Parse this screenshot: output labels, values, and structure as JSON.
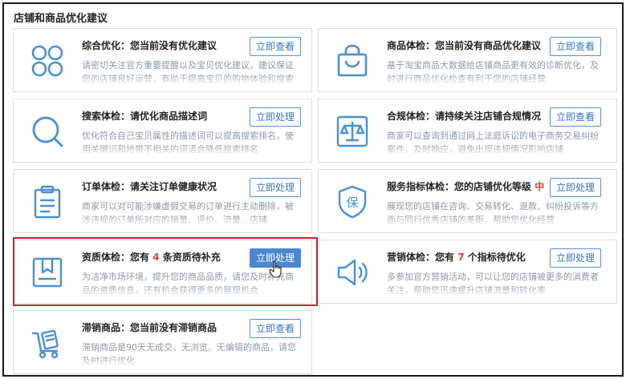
{
  "section_title": "店铺和商品优化建议",
  "cards": [
    {
      "icon": "apps-grid-icon",
      "title": "综合优化：您当前没有优化建议",
      "button": "立即查看",
      "desc": "请密切关注官方重要提醒以及宝贝优化建议，建议保证您的店铺良好运营，有助于提高宝贝的购物体验和搜索曝光"
    },
    {
      "icon": "shopping-bag-icon",
      "title": "商品体检：您当前没有商品优化建议",
      "button": "立即查看",
      "desc": "基于淘宝商品大数据给店铺商品更有效的诊断优化，及时进行商品优化检查有利于您的店铺经营"
    },
    {
      "icon": "search-icon",
      "title": "搜索体检：请优化商品描述词",
      "button": "立即处理",
      "desc": "优化符合自己宝贝属性的描述词可以提高搜索排名，使用关键词和地带不相关的词语会降低搜索排名"
    },
    {
      "icon": "scale-icon",
      "title": "合规体检：请持续关注店铺合规情况",
      "button": "立即查看",
      "desc": "商家可以查询到通过网上法庭诉讼的电子商务交易纠纷案件，及时响应，避免出现违规情况影响店铺"
    },
    {
      "icon": "clipboard-icon",
      "title": "订单体检：请关注订单健康状况",
      "button": "立即处理",
      "desc": "商家可以对可能涉嫌虚假交易的订单进行主动删除，被涉违规的订单所对应的销量、评价、流量、店铺"
    },
    {
      "icon": "shield-icon",
      "title": "服务指标体检：您的店铺优化等级",
      "title_badge": "中",
      "button": "立即处理",
      "desc": "展现您的店铺在咨询、交易转化、退款、纠纷投诉等方面与同行优秀店铺的差距，帮助您优化经营"
    },
    {
      "icon": "certificate-icon",
      "title_prefix": "资质体检：您有",
      "title_num": "4",
      "title_suffix": "条资质待补充",
      "button": "立即处理",
      "desc": "为洁净市场环境，提升您的商品品质，请您及时补充商品的资质信息，还有机会获得更多的展现机会"
    },
    {
      "icon": "speaker-icon",
      "title_prefix": "营销体检：您有",
      "title_num": "7",
      "title_suffix": "个指标待优化",
      "button": "立即处理",
      "desc": "多参加官方营销活动，可以让您的店铺被更多的消费者关注，帮助您迅速提升店铺流量和转化率"
    },
    {
      "icon": "cart-icon",
      "title": "滞销商品：您当前没有滞销商品",
      "button": "立即查看",
      "desc": "滞销商品是90天无成交、无浏览、无编辑的商品，请您及时进行优化"
    }
  ]
}
